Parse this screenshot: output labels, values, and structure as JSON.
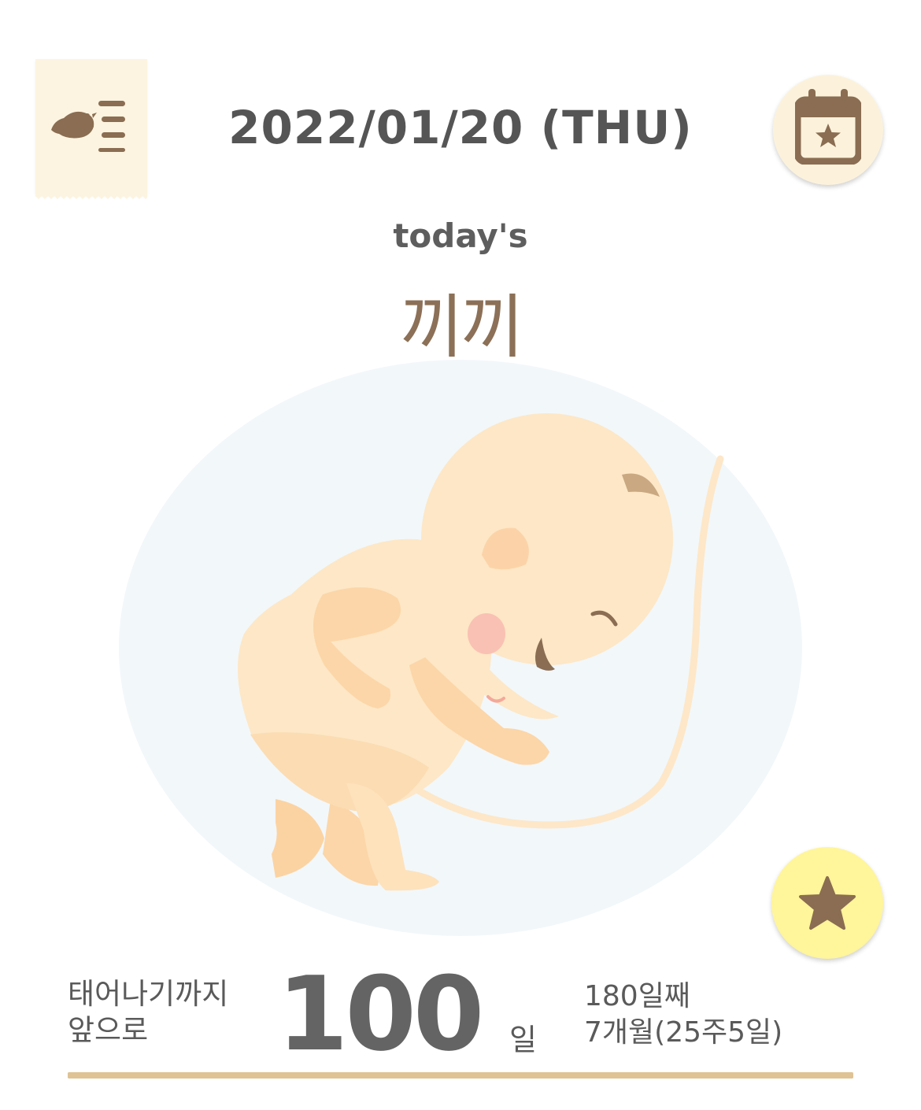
{
  "header": {
    "date": "2022/01/20 (THU)",
    "menu_icon": "bird-menu-icon",
    "calendar_icon": "calendar-star-icon"
  },
  "hero": {
    "todays_label": "today's",
    "baby_name": "끼끼",
    "illustration": "fetus-illustration"
  },
  "favorite": {
    "icon": "star-icon"
  },
  "countdown": {
    "label_line1": "태어나기까지",
    "label_line2": "앞으로",
    "days_remaining": "100",
    "unit": "일",
    "day_count": "180일째",
    "month_week": "7개월(25주5일)",
    "progress_fraction": 1.0
  },
  "colors": {
    "brown": "#8c7057",
    "cream": "#fcf4e0",
    "yellow": "#fff59a",
    "progress": "#dfc394",
    "text": "#5a5a5a"
  }
}
